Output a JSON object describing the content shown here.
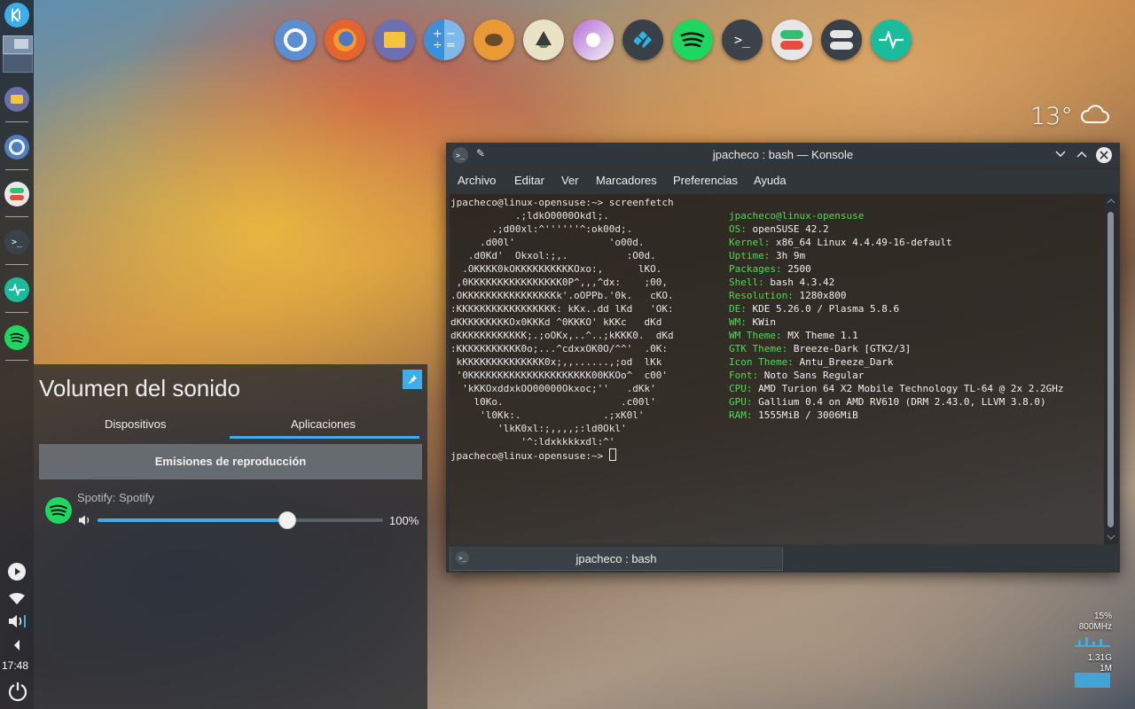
{
  "panel": {
    "clock": "17:48"
  },
  "dock": {
    "icons": [
      "chromium-icon",
      "firefox-icon",
      "files-icon",
      "calculator-icon",
      "gimp-icon",
      "inkscape-icon",
      "krita-icon",
      "kodi-icon",
      "spotify-icon",
      "terminal-icon",
      "toggles-icon",
      "settings-toggle-icon",
      "system-monitor-icon"
    ]
  },
  "weather": {
    "temperature": "13°"
  },
  "konsole": {
    "title": "jpacheco : bash — Konsole",
    "menu": [
      "Archivo",
      "Editar",
      "Ver",
      "Marcadores",
      "Preferencias",
      "Ayuda"
    ],
    "tab_label": "jpacheco : bash",
    "prompt_line": "jpacheco@linux-opensuse:~> screenfetch",
    "final_prompt": "jpacheco@linux-opensuse:~> ",
    "ascii_art": [
      "           .;ldkO0000Okdl;.",
      "       .;d00xl:^''''''^:ok00d;.",
      "     .d00l'                'o00d.",
      "   .d0Kd'  Okxol:;,.          :O0d.",
      "  .OKKKK0kOKKKKKKKKKKOxo:,      lKO.",
      " ,0KKKKKKKKKKKKKKKK0P^,,,^dx:    ;00,",
      ".OKKKKKKKKKKKKKKKKk'.oOPPb.'0k.   cKO.",
      ":KKKKKKKKKKKKKKKKK: kKx..dd lKd   'OK:",
      "dKKKKKKKKKOx0KKKd ^0KKKO' kKKc   dKd",
      "dKKKKKKKKKKKK;.;oOKx,..^..;kKKK0.  dKd",
      ":KKKKKKKKKKK0o;...^cdxxOK0O/^^'  .0K:",
      " kKKKKKKKKKKKKKK0x;,,......,;od  lKk",
      " '0KKKKKKKKKKKKKKKKKKKKK00KKOo^  c00'",
      "  'kKKOxddxkOO00000Okxoc;''   .dKk'",
      "    l0Ko.                    .c00l'",
      "     'l0Kk:.              .;xK0l'",
      "        'lkK0xl:;,,,,;:ld0Okl'",
      "            '^:ldxkkkkxdl:^'"
    ],
    "info": [
      {
        "key": "",
        "value": "jpacheco@linux-opensuse"
      },
      {
        "key": "OS:",
        "value": " openSUSE 42.2"
      },
      {
        "key": "Kernel:",
        "value": " x86_64 Linux 4.4.49-16-default"
      },
      {
        "key": "Uptime:",
        "value": " 3h 9m"
      },
      {
        "key": "Packages:",
        "value": " 2500"
      },
      {
        "key": "Shell:",
        "value": " bash 4.3.42"
      },
      {
        "key": "Resolution:",
        "value": " 1280x800"
      },
      {
        "key": "DE:",
        "value": " KDE 5.26.0 / Plasma 5.8.6"
      },
      {
        "key": "WM:",
        "value": " KWin"
      },
      {
        "key": "WM Theme:",
        "value": " MX Theme 1.1"
      },
      {
        "key": "GTK Theme:",
        "value": " Breeze-Dark [GTK2/3]"
      },
      {
        "key": "Icon Theme:",
        "value": " Antu_Breeze_Dark"
      },
      {
        "key": "Font:",
        "value": " Noto Sans Regular"
      },
      {
        "key": "CPU:",
        "value": " AMD Turion 64 X2 Mobile Technology TL-64 @ 2x 2.2GHz"
      },
      {
        "key": "GPU:",
        "value": " Gallium 0.4 on AMD RV610 (DRM 2.43.0, LLVM 3.8.0)"
      },
      {
        "key": "RAM:",
        "value": " 1555MiB / 3006MiB"
      }
    ]
  },
  "volume": {
    "title": "Volumen del sonido",
    "tabs": [
      "Dispositivos",
      "Aplicaciones"
    ],
    "active_tab": "Aplicaciones",
    "section": "Emisiones de reproducción",
    "stream_name": "Spotify: Spotify",
    "level_percent": 100,
    "level_label": "100%",
    "slider_fraction": 0.66
  },
  "monitors": {
    "cpu_percent": "15%",
    "cpu_freq": "800MHz",
    "mem": "1.31G",
    "swap": "1M"
  },
  "colors": {
    "accent": "#3daee9",
    "terminal_green": "#4edb4e",
    "spotify": "#1ed760"
  }
}
